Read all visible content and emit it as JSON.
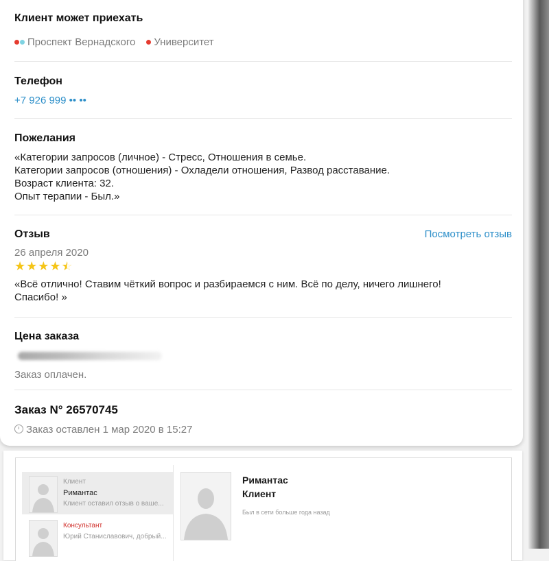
{
  "order": {
    "metro_section": {
      "title": "Клиент может приехать",
      "stations": [
        {
          "name": "Проспект Вернадского",
          "colors": [
            "#e53b2f",
            "#7fd3e2"
          ]
        },
        {
          "name": "Университет",
          "colors": [
            "#e53b2f"
          ]
        }
      ]
    },
    "phone_section": {
      "title": "Телефон",
      "phone": "+7 926 999 •• ••"
    },
    "wishes_section": {
      "title": "Пожелания",
      "lines": [
        "«Категории запросов (личное) - Стресс, Отношения в семье.",
        "Категории запросов (отношения) - Охладели отношения, Развод расставание.",
        "Возраст клиента: 32.",
        "Опыт терапии - Был.»"
      ]
    },
    "review_section": {
      "title": "Отзыв",
      "view_link": "Посмотреть отзыв",
      "date": "26 апреля 2020",
      "rating": 4.5,
      "text_lines": [
        "«Всё отлично! Ставим чёткий вопрос и разбираемся с ним. Всё по делу, ничего лишнего!",
        "Спасибо! »"
      ]
    },
    "price_section": {
      "title": "Цена заказа",
      "paid_status": "Заказ оплачен."
    },
    "order_info": {
      "title": "Заказ N° 26570745",
      "created": "Заказ оставлен 1 мар 2020 в 15:27"
    }
  },
  "chat": {
    "conversations": [
      {
        "role": "Клиент",
        "name": "Римантас",
        "preview": "Клиент оставил отзыв о ваше...",
        "role_color": "#9a9a9a"
      },
      {
        "role": "Консультант",
        "name": "",
        "preview": "Юрий Станиславович, добрый...",
        "role_color": "#d0302b"
      }
    ],
    "profile": {
      "name": "Римантас",
      "role": "Клиент",
      "last_seen": "Был в сети больше года назад"
    }
  },
  "colors": {
    "link": "#2d8fc9",
    "star": "#f5c518",
    "accent_red": "#d0302b"
  }
}
